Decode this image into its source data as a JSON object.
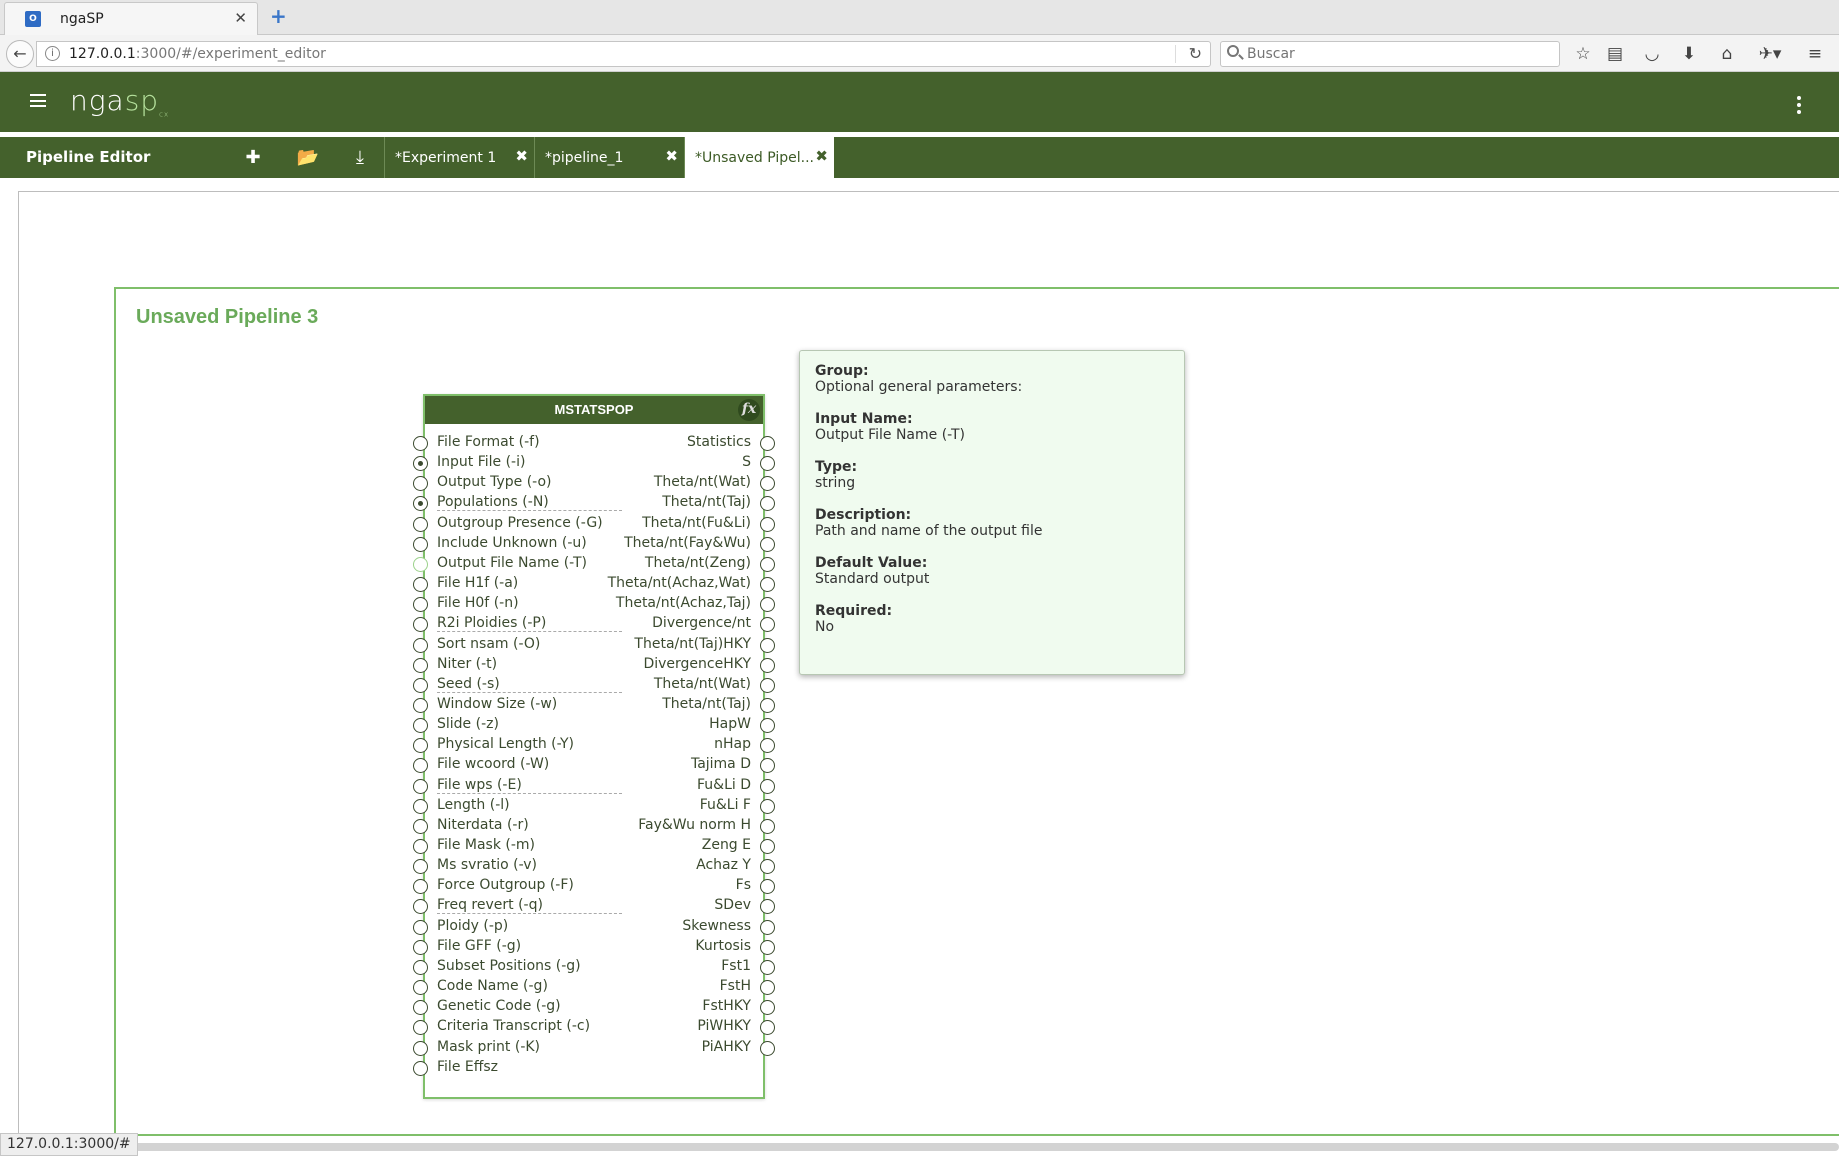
{
  "browser": {
    "tab_title": "ngaSP",
    "favicon_text": "O",
    "url_host": "127.0.0.1",
    "url_rest": ":3000/#/experiment_editor",
    "search_placeholder": "Buscar"
  },
  "app": {
    "logo_main": "nga",
    "logo_accent": "sp",
    "logo_sub": "cx"
  },
  "toolbar": {
    "title": "Pipeline Editor",
    "tabs": [
      {
        "label": "*Experiment 1"
      },
      {
        "label": "*pipeline_1"
      },
      {
        "label": "*Unsaved Pipel..."
      }
    ]
  },
  "pipeline": {
    "title": "Unsaved Pipeline 3",
    "node": {
      "title": "MSTATSPOP",
      "fx_label": "fx",
      "inputs": [
        {
          "label": "File Format (-f)"
        },
        {
          "label": "Input File (-i)"
        },
        {
          "label": "Output Type (-o)"
        },
        {
          "label": "Populations (-N)"
        },
        {
          "label": "Outgroup Presence (-G)"
        },
        {
          "label": "Include Unknown (-u)"
        },
        {
          "label": "Output File Name (-T)"
        },
        {
          "label": "File H1f (-a)"
        },
        {
          "label": "File H0f (-n)"
        },
        {
          "label": "R2i Ploidies (-P)"
        },
        {
          "label": "Sort nsam (-O)"
        },
        {
          "label": "Niter (-t)"
        },
        {
          "label": "Seed (-s)"
        },
        {
          "label": "Window Size (-w)"
        },
        {
          "label": "Slide (-z)"
        },
        {
          "label": "Physical Length (-Y)"
        },
        {
          "label": "File wcoord (-W)"
        },
        {
          "label": "File wps (-E)"
        },
        {
          "label": "Length (-l)"
        },
        {
          "label": "Niterdata (-r)"
        },
        {
          "label": "File Mask (-m)"
        },
        {
          "label": "Ms svratio (-v)"
        },
        {
          "label": "Force Outgroup (-F)"
        },
        {
          "label": "Freq revert (-q)"
        },
        {
          "label": "Ploidy (-p)"
        },
        {
          "label": "File GFF (-g)"
        },
        {
          "label": "Subset Positions (-g)"
        },
        {
          "label": "Code Name (-g)"
        },
        {
          "label": "Genetic Code (-g)"
        },
        {
          "label": "Criteria Transcript (-c)"
        },
        {
          "label": "Mask print (-K)"
        },
        {
          "label": "File Effsz"
        }
      ],
      "outputs": [
        {
          "label": "Statistics"
        },
        {
          "label": "S"
        },
        {
          "label": "Theta/nt(Wat)"
        },
        {
          "label": "Theta/nt(Taj)"
        },
        {
          "label": "Theta/nt(Fu&Li)"
        },
        {
          "label": "Theta/nt(Fay&Wu)"
        },
        {
          "label": "Theta/nt(Zeng)"
        },
        {
          "label": "Theta/nt(Achaz,Wat)"
        },
        {
          "label": "Theta/nt(Achaz,Taj)"
        },
        {
          "label": "Divergence/nt"
        },
        {
          "label": "Theta/nt(Taj)HKY"
        },
        {
          "label": "DivergenceHKY"
        },
        {
          "label": "Theta/nt(Wat)"
        },
        {
          "label": "Theta/nt(Taj)"
        },
        {
          "label": "HapW"
        },
        {
          "label": "nHap"
        },
        {
          "label": "Tajima D"
        },
        {
          "label": "Fu&Li D"
        },
        {
          "label": "Fu&Li F"
        },
        {
          "label": "Fay&Wu norm H"
        },
        {
          "label": "Zeng E"
        },
        {
          "label": "Achaz Y"
        },
        {
          "label": "Fs"
        },
        {
          "label": "SDev"
        },
        {
          "label": "Skewness"
        },
        {
          "label": "Kurtosis"
        },
        {
          "label": "Fst1"
        },
        {
          "label": "FstH"
        },
        {
          "label": "FstHKY"
        },
        {
          "label": "PiWHKY"
        },
        {
          "label": "PiAHKY"
        }
      ]
    }
  },
  "tooltip": {
    "group_label": "Group:",
    "group_value": "Optional general parameters:",
    "name_label": "Input Name:",
    "name_value": "Output File Name (-T)",
    "type_label": "Type:",
    "type_value": "string",
    "desc_label": "Description:",
    "desc_value": "Path and name of the output file",
    "default_label": "Default Value:",
    "default_value": "Standard output",
    "required_label": "Required:",
    "required_value": "No"
  },
  "status_url": "127.0.0.1:3000/#",
  "colors": {
    "brand_green": "#44612c",
    "pipeline_border": "#7fbf6a",
    "pipeline_title": "#6aaa5a",
    "tooltip_bg": "#f0fbef"
  }
}
